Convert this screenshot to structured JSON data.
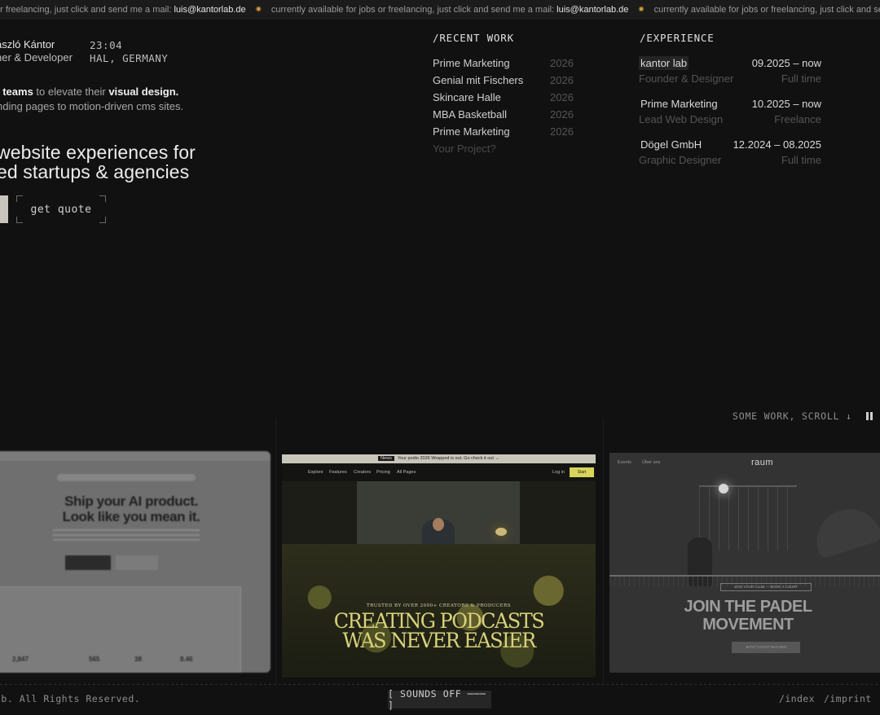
{
  "marquee": {
    "partial_start": "or freelancing, just click and send me a mail:",
    "message": "currently available for jobs or freelancing, just click and send me a mail:",
    "partial_end": "currently available for jobs or freelancing, just click and send me a",
    "email": "luis@kantorlab.de",
    "separator_icon": "sun-icon"
  },
  "identity": {
    "name": "ászló Kántor",
    "role": "ner & Developer",
    "time": "23:04",
    "location": "HAL, GERMANY"
  },
  "intro": {
    "line1_strong_a": "l teams",
    "line1_text": " to elevate their ",
    "line1_strong_b": "visual design.",
    "line2": "nding pages to motion-driven cms sites."
  },
  "headline": {
    "line1": "website experiences for",
    "line2": "ed startups & agencies"
  },
  "cta": {
    "quote_label": "get quote"
  },
  "recent_work": {
    "title": "/RECENT WORK",
    "items": [
      {
        "name": "Prime Marketing",
        "year": "2026"
      },
      {
        "name": "Genial mit Fischers",
        "year": "2026"
      },
      {
        "name": "Skincare Halle",
        "year": "2026"
      },
      {
        "name": "MBA Basketball",
        "year": "2026"
      },
      {
        "name": "Prime Marketing",
        "year": "2026"
      }
    ],
    "more": "Your Project?"
  },
  "experience": {
    "title": "/EXPERIENCE",
    "items": [
      {
        "company": "kantor lab",
        "dates": "09.2025 – now",
        "role": "Founder & Designer",
        "type": "Full time"
      },
      {
        "company": "Prime Marketing",
        "dates": "10.2025 – now",
        "role": "Lead Web Design",
        "type": "Freelance"
      },
      {
        "company": "Dögel GmbH",
        "dates": "12.2024 – 08.2025",
        "role": "Graphic Designer",
        "type": "Full time"
      }
    ]
  },
  "scroll_hint": {
    "label": "SOME WORK, SCROLL ↓",
    "pause_icon": "pause-icon"
  },
  "gallery": {
    "card1": {
      "headline_1": "Ship your AI product.",
      "headline_2": "Look like you mean it.",
      "stats": [
        "2,847",
        "565",
        "38",
        "8.46"
      ]
    },
    "card2": {
      "news_badge": "News",
      "news_text": "Your podio 2026 Wrapped is out. Go check it out →",
      "nav": [
        "Explore",
        "Features",
        "Creators",
        "Pricing",
        "All Pages"
      ],
      "login": "Log in",
      "start": "Start recording",
      "tagline": "TRUSTED BY OVER 2000+ CREATORS & PRODUCERS",
      "headline_1": "CREATING PODCASTS",
      "headline_2": "WAS NEVER EASIER"
    },
    "card3": {
      "logo": "raum",
      "nav": [
        "Events",
        "Über uns"
      ],
      "pill": "JOIN YOUR CLUB — BOOK A COURT",
      "headline_1": "JOIN THE PADEL",
      "headline_2": "MOVEMENT",
      "button": "JETZT COURT BUCHEN"
    }
  },
  "footer": {
    "copyright": "ab. All Rights Reserved.",
    "sounds": "[ SOUNDS OFF ─── ]",
    "links": [
      "/index",
      "/imprint"
    ]
  }
}
